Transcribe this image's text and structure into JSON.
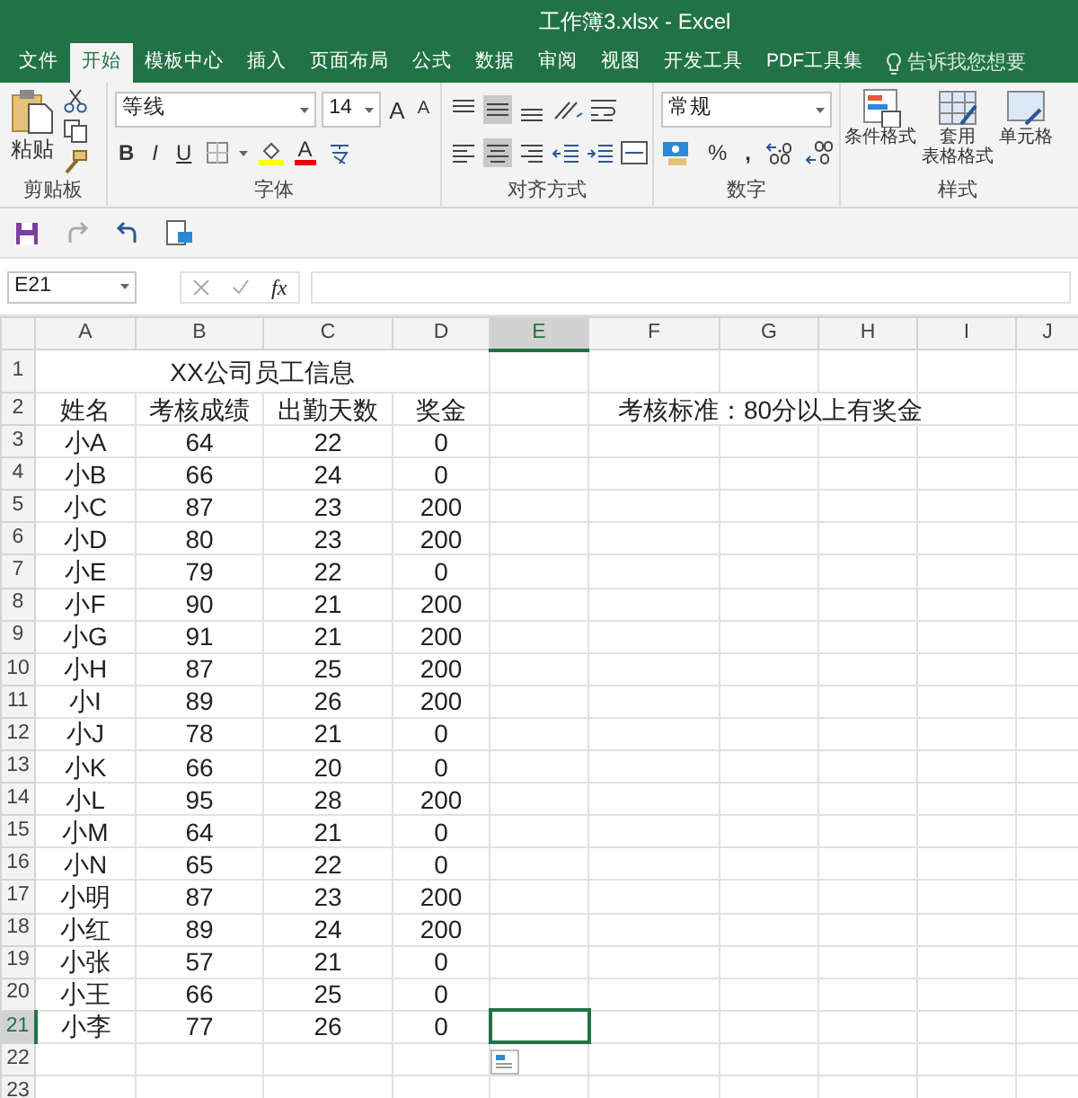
{
  "window": {
    "title": "工作簿3.xlsx - Excel"
  },
  "ribbon_tabs": [
    {
      "label": "文件",
      "selected": false
    },
    {
      "label": "开始",
      "selected": true
    },
    {
      "label": "模板中心",
      "selected": false
    },
    {
      "label": "插入",
      "selected": false
    },
    {
      "label": "页面布局",
      "selected": false
    },
    {
      "label": "公式",
      "selected": false
    },
    {
      "label": "数据",
      "selected": false
    },
    {
      "label": "审阅",
      "selected": false
    },
    {
      "label": "视图",
      "selected": false
    },
    {
      "label": "开发工具",
      "selected": false
    },
    {
      "label": "PDF工具集",
      "selected": false
    }
  ],
  "tell_me": {
    "placeholder": "告诉我您想要"
  },
  "ribbon": {
    "clipboard": {
      "paste": "粘贴",
      "label": "剪贴板"
    },
    "font": {
      "font_name": "等线",
      "font_size": "14",
      "grow": "A",
      "shrink": "A",
      "bold": "B",
      "italic": "I",
      "underline": "U",
      "font_color": "A",
      "label": "字体"
    },
    "alignment": {
      "label": "对齐方式"
    },
    "number": {
      "format": "常规",
      "percent": "%",
      "comma": ",",
      "label": "数字"
    },
    "styles": {
      "buttons": [
        {
          "lines": [
            "条件格式"
          ]
        },
        {
          "lines": [
            "套用",
            "表格格式"
          ]
        },
        {
          "lines": [
            "单元格"
          ]
        }
      ],
      "label": "样式"
    }
  },
  "formula_bar": {
    "name_box": "E21",
    "function_label": "fx"
  },
  "sheet": {
    "columns": [
      {
        "label": "A",
        "selected": false
      },
      {
        "label": "B",
        "selected": false
      },
      {
        "label": "C",
        "selected": false
      },
      {
        "label": "D",
        "selected": false
      },
      {
        "label": "E",
        "selected": true
      },
      {
        "label": "F",
        "selected": false
      },
      {
        "label": "G",
        "selected": false
      },
      {
        "label": "H",
        "selected": false
      },
      {
        "label": "I",
        "selected": false
      },
      {
        "label": "J",
        "selected": false
      }
    ],
    "rows": [
      {
        "label": "1",
        "selected": false
      },
      {
        "label": "2",
        "selected": false
      },
      {
        "label": "3",
        "selected": false
      },
      {
        "label": "4",
        "selected": false
      },
      {
        "label": "5",
        "selected": false
      },
      {
        "label": "6",
        "selected": false
      },
      {
        "label": "7",
        "selected": false
      },
      {
        "label": "8",
        "selected": false
      },
      {
        "label": "9",
        "selected": false
      },
      {
        "label": "10",
        "selected": false
      },
      {
        "label": "11",
        "selected": false
      },
      {
        "label": "12",
        "selected": false
      },
      {
        "label": "13",
        "selected": false
      },
      {
        "label": "14",
        "selected": false
      },
      {
        "label": "15",
        "selected": false
      },
      {
        "label": "16",
        "selected": false
      },
      {
        "label": "17",
        "selected": false
      },
      {
        "label": "18",
        "selected": false
      },
      {
        "label": "19",
        "selected": false
      },
      {
        "label": "20",
        "selected": false
      },
      {
        "label": "21",
        "selected": true
      },
      {
        "label": "22",
        "selected": false
      },
      {
        "label": "23",
        "selected": false
      }
    ],
    "title": "XX公司员工信息",
    "headers": [
      "姓名",
      "考核成绩",
      "出勤天数",
      "奖金"
    ],
    "note": "考核标准：80分以上有奖金",
    "records": [
      [
        "小A",
        "64",
        "22",
        "0"
      ],
      [
        "小B",
        "66",
        "24",
        "0"
      ],
      [
        "小C",
        "87",
        "23",
        "200"
      ],
      [
        "小D",
        "80",
        "23",
        "200"
      ],
      [
        "小E",
        "79",
        "22",
        "0"
      ],
      [
        "小F",
        "90",
        "21",
        "200"
      ],
      [
        "小G",
        "91",
        "21",
        "200"
      ],
      [
        "小H",
        "87",
        "25",
        "200"
      ],
      [
        "小I",
        "89",
        "26",
        "200"
      ],
      [
        "小J",
        "78",
        "21",
        "0"
      ],
      [
        "小K",
        "66",
        "20",
        "0"
      ],
      [
        "小L",
        "95",
        "28",
        "200"
      ],
      [
        "小M",
        "64",
        "21",
        "0"
      ],
      [
        "小N",
        "65",
        "22",
        "0"
      ],
      [
        "小明",
        "87",
        "23",
        "200"
      ],
      [
        "小红",
        "89",
        "24",
        "200"
      ],
      [
        "小张",
        "57",
        "21",
        "0"
      ],
      [
        "小王",
        "66",
        "25",
        "0"
      ],
      [
        "小李",
        "77",
        "26",
        "0"
      ]
    ]
  }
}
